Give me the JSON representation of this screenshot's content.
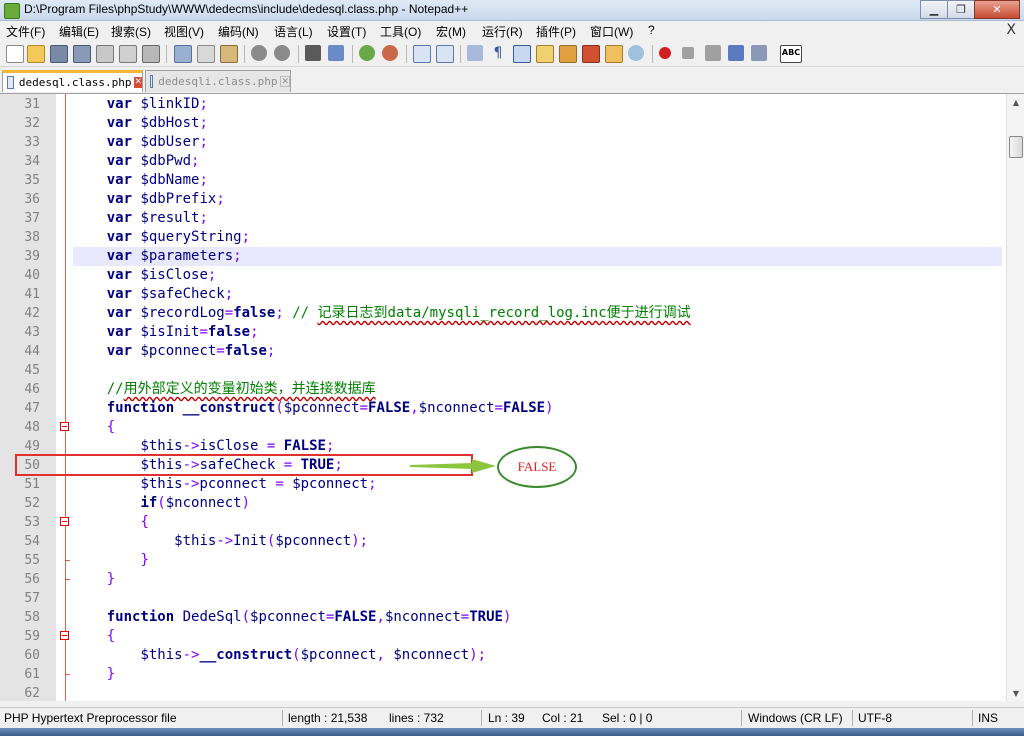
{
  "window": {
    "title": "D:\\Program Files\\phpStudy\\WWW\\dedecms\\include\\dedesql.class.php - Notepad++",
    "minimize": "▁",
    "restore": "❐",
    "close": "✕"
  },
  "menu": {
    "items": [
      "文件(F)",
      "编辑(E)",
      "搜索(S)",
      "视图(V)",
      "编码(N)",
      "语言(L)",
      "设置(T)",
      "工具(O)",
      "宏(M)",
      "运行(R)",
      "插件(P)",
      "窗口(W)",
      "?"
    ],
    "close_doc": "X"
  },
  "tabs": [
    {
      "label": "dedesql.class.php",
      "active": true
    },
    {
      "label": "dedesqli.class.php",
      "active": false
    }
  ],
  "editor": {
    "current_line": 39,
    "lines": [
      {
        "n": "31",
        "tokens": [
          {
            "t": "    "
          },
          {
            "c": "kw",
            "t": "var"
          },
          {
            "t": " "
          },
          {
            "c": "var",
            "t": "$linkID"
          },
          {
            "c": "op",
            "t": ";"
          }
        ]
      },
      {
        "n": "32",
        "tokens": [
          {
            "t": "    "
          },
          {
            "c": "kw",
            "t": "var"
          },
          {
            "t": " "
          },
          {
            "c": "var",
            "t": "$dbHost"
          },
          {
            "c": "op",
            "t": ";"
          }
        ]
      },
      {
        "n": "33",
        "tokens": [
          {
            "t": "    "
          },
          {
            "c": "kw",
            "t": "var"
          },
          {
            "t": " "
          },
          {
            "c": "var",
            "t": "$dbUser"
          },
          {
            "c": "op",
            "t": ";"
          }
        ]
      },
      {
        "n": "34",
        "tokens": [
          {
            "t": "    "
          },
          {
            "c": "kw",
            "t": "var"
          },
          {
            "t": " "
          },
          {
            "c": "var",
            "t": "$dbPwd"
          },
          {
            "c": "op",
            "t": ";"
          }
        ]
      },
      {
        "n": "35",
        "tokens": [
          {
            "t": "    "
          },
          {
            "c": "kw",
            "t": "var"
          },
          {
            "t": " "
          },
          {
            "c": "var",
            "t": "$dbName"
          },
          {
            "c": "op",
            "t": ";"
          }
        ]
      },
      {
        "n": "36",
        "tokens": [
          {
            "t": "    "
          },
          {
            "c": "kw",
            "t": "var"
          },
          {
            "t": " "
          },
          {
            "c": "var",
            "t": "$dbPrefix"
          },
          {
            "c": "op",
            "t": ";"
          }
        ]
      },
      {
        "n": "37",
        "tokens": [
          {
            "t": "    "
          },
          {
            "c": "kw",
            "t": "var"
          },
          {
            "t": " "
          },
          {
            "c": "var",
            "t": "$result"
          },
          {
            "c": "op",
            "t": ";"
          }
        ]
      },
      {
        "n": "38",
        "tokens": [
          {
            "t": "    "
          },
          {
            "c": "kw",
            "t": "var"
          },
          {
            "t": " "
          },
          {
            "c": "var",
            "t": "$queryString"
          },
          {
            "c": "op",
            "t": ";"
          }
        ]
      },
      {
        "n": "39",
        "tokens": [
          {
            "t": "    "
          },
          {
            "c": "kw",
            "t": "var"
          },
          {
            "t": " "
          },
          {
            "c": "var",
            "t": "$parameters"
          },
          {
            "c": "op",
            "t": ";"
          }
        ]
      },
      {
        "n": "40",
        "tokens": [
          {
            "t": "    "
          },
          {
            "c": "kw",
            "t": "var"
          },
          {
            "t": " "
          },
          {
            "c": "var",
            "t": "$isClose"
          },
          {
            "c": "op",
            "t": ";"
          }
        ]
      },
      {
        "n": "41",
        "tokens": [
          {
            "t": "    "
          },
          {
            "c": "kw",
            "t": "var"
          },
          {
            "t": " "
          },
          {
            "c": "var",
            "t": "$safeCheck"
          },
          {
            "c": "op",
            "t": ";"
          }
        ]
      },
      {
        "n": "42",
        "tokens": [
          {
            "t": "    "
          },
          {
            "c": "kw",
            "t": "var"
          },
          {
            "t": " "
          },
          {
            "c": "var",
            "t": "$recordLog"
          },
          {
            "c": "op",
            "t": "="
          },
          {
            "c": "kw",
            "t": "false"
          },
          {
            "c": "op",
            "t": ";"
          },
          {
            "t": " "
          },
          {
            "c": "cm-en",
            "t": "// "
          },
          {
            "c": "cm-zh",
            "t": "记录日志到data/mysqli_record_log.inc便于进行调试"
          }
        ]
      },
      {
        "n": "43",
        "tokens": [
          {
            "t": "    "
          },
          {
            "c": "kw",
            "t": "var"
          },
          {
            "t": " "
          },
          {
            "c": "var",
            "t": "$isInit"
          },
          {
            "c": "op",
            "t": "="
          },
          {
            "c": "kw",
            "t": "false"
          },
          {
            "c": "op",
            "t": ";"
          }
        ]
      },
      {
        "n": "44",
        "tokens": [
          {
            "t": "    "
          },
          {
            "c": "kw",
            "t": "var"
          },
          {
            "t": " "
          },
          {
            "c": "var",
            "t": "$pconnect"
          },
          {
            "c": "op",
            "t": "="
          },
          {
            "c": "kw",
            "t": "false"
          },
          {
            "c": "op",
            "t": ";"
          }
        ]
      },
      {
        "n": "45",
        "tokens": []
      },
      {
        "n": "46",
        "tokens": [
          {
            "t": "    "
          },
          {
            "c": "cm-en",
            "t": "//"
          },
          {
            "c": "cm-zh",
            "t": "用外部定义的变量初始类，并连接数据库"
          }
        ]
      },
      {
        "n": "47",
        "tokens": [
          {
            "t": "    "
          },
          {
            "c": "kw",
            "t": "function"
          },
          {
            "t": " "
          },
          {
            "c": "kw",
            "t": "__construct"
          },
          {
            "c": "op",
            "t": "("
          },
          {
            "c": "var",
            "t": "$pconnect"
          },
          {
            "c": "op",
            "t": "="
          },
          {
            "c": "kw",
            "t": "FALSE"
          },
          {
            "c": "op",
            "t": ","
          },
          {
            "c": "var",
            "t": "$nconnect"
          },
          {
            "c": "op",
            "t": "="
          },
          {
            "c": "kw",
            "t": "FALSE"
          },
          {
            "c": "op",
            "t": ")"
          }
        ]
      },
      {
        "n": "48",
        "tokens": [
          {
            "t": "    "
          },
          {
            "c": "op",
            "t": "{"
          }
        ]
      },
      {
        "n": "49",
        "tokens": [
          {
            "t": "        "
          },
          {
            "c": "var",
            "t": "$this"
          },
          {
            "c": "op",
            "t": "->"
          },
          {
            "c": "var",
            "t": "isClose"
          },
          {
            "t": " "
          },
          {
            "c": "op",
            "t": "="
          },
          {
            "t": " "
          },
          {
            "c": "kw",
            "t": "FALSE"
          },
          {
            "c": "op",
            "t": ";"
          }
        ]
      },
      {
        "n": "50",
        "tokens": [
          {
            "t": "        "
          },
          {
            "c": "var",
            "t": "$this"
          },
          {
            "c": "op",
            "t": "->"
          },
          {
            "c": "var",
            "t": "safeCheck"
          },
          {
            "t": " "
          },
          {
            "c": "op",
            "t": "="
          },
          {
            "t": " "
          },
          {
            "c": "kw",
            "t": "TRUE"
          },
          {
            "c": "op",
            "t": ";"
          }
        ]
      },
      {
        "n": "51",
        "tokens": [
          {
            "t": "        "
          },
          {
            "c": "var",
            "t": "$this"
          },
          {
            "c": "op",
            "t": "->"
          },
          {
            "c": "var",
            "t": "pconnect"
          },
          {
            "t": " "
          },
          {
            "c": "op",
            "t": "="
          },
          {
            "t": " "
          },
          {
            "c": "var",
            "t": "$pconnect"
          },
          {
            "c": "op",
            "t": ";"
          }
        ]
      },
      {
        "n": "52",
        "tokens": [
          {
            "t": "        "
          },
          {
            "c": "kw",
            "t": "if"
          },
          {
            "c": "op",
            "t": "("
          },
          {
            "c": "var",
            "t": "$nconnect"
          },
          {
            "c": "op",
            "t": ")"
          }
        ]
      },
      {
        "n": "53",
        "tokens": [
          {
            "t": "        "
          },
          {
            "c": "op",
            "t": "{"
          }
        ]
      },
      {
        "n": "54",
        "tokens": [
          {
            "t": "            "
          },
          {
            "c": "var",
            "t": "$this"
          },
          {
            "c": "op",
            "t": "->"
          },
          {
            "c": "var",
            "t": "Init"
          },
          {
            "c": "op",
            "t": "("
          },
          {
            "c": "var",
            "t": "$pconnect"
          },
          {
            "c": "op",
            "t": ");"
          }
        ]
      },
      {
        "n": "55",
        "tokens": [
          {
            "t": "        "
          },
          {
            "c": "op",
            "t": "}"
          }
        ]
      },
      {
        "n": "56",
        "tokens": [
          {
            "t": "    "
          },
          {
            "c": "op",
            "t": "}"
          }
        ]
      },
      {
        "n": "57",
        "tokens": []
      },
      {
        "n": "58",
        "tokens": [
          {
            "t": "    "
          },
          {
            "c": "kw",
            "t": "function"
          },
          {
            "t": " "
          },
          {
            "c": "var",
            "t": "DedeSql"
          },
          {
            "c": "op",
            "t": "("
          },
          {
            "c": "var",
            "t": "$pconnect"
          },
          {
            "c": "op",
            "t": "="
          },
          {
            "c": "kw",
            "t": "FALSE"
          },
          {
            "c": "op",
            "t": ","
          },
          {
            "c": "var",
            "t": "$nconnect"
          },
          {
            "c": "op",
            "t": "="
          },
          {
            "c": "kw",
            "t": "TRUE"
          },
          {
            "c": "op",
            "t": ")"
          }
        ]
      },
      {
        "n": "59",
        "tokens": [
          {
            "t": "    "
          },
          {
            "c": "op",
            "t": "{"
          }
        ]
      },
      {
        "n": "60",
        "tokens": [
          {
            "t": "        "
          },
          {
            "c": "var",
            "t": "$this"
          },
          {
            "c": "op",
            "t": "->"
          },
          {
            "c": "kw",
            "t": "__construct"
          },
          {
            "c": "op",
            "t": "("
          },
          {
            "c": "var",
            "t": "$pconnect"
          },
          {
            "c": "op",
            "t": ","
          },
          {
            "t": " "
          },
          {
            "c": "var",
            "t": "$nconnect"
          },
          {
            "c": "op",
            "t": ");"
          }
        ]
      },
      {
        "n": "61",
        "tokens": [
          {
            "t": "    "
          },
          {
            "c": "op",
            "t": "}"
          }
        ]
      },
      {
        "n": "62",
        "tokens": []
      }
    ]
  },
  "annotation": {
    "label": "FALSE",
    "rect_color": "#e03030",
    "arrow_color": "#8cc63f",
    "ellipse_color": "#3b8a2e"
  },
  "status": {
    "filetype": "PHP Hypertext Preprocessor file",
    "length": "length : 21,538",
    "lines": "lines : 732",
    "ln": "Ln : 39",
    "col": "Col : 21",
    "sel": "Sel : 0 | 0",
    "eol": "Windows (CR LF)",
    "encoding": "UTF-8",
    "mode": "INS"
  },
  "colors": {
    "keyword": "#000080",
    "operator": "#8000ff",
    "comment": "#008000",
    "current_line": "#e8e8ff",
    "tab_accent": "#fab637"
  }
}
